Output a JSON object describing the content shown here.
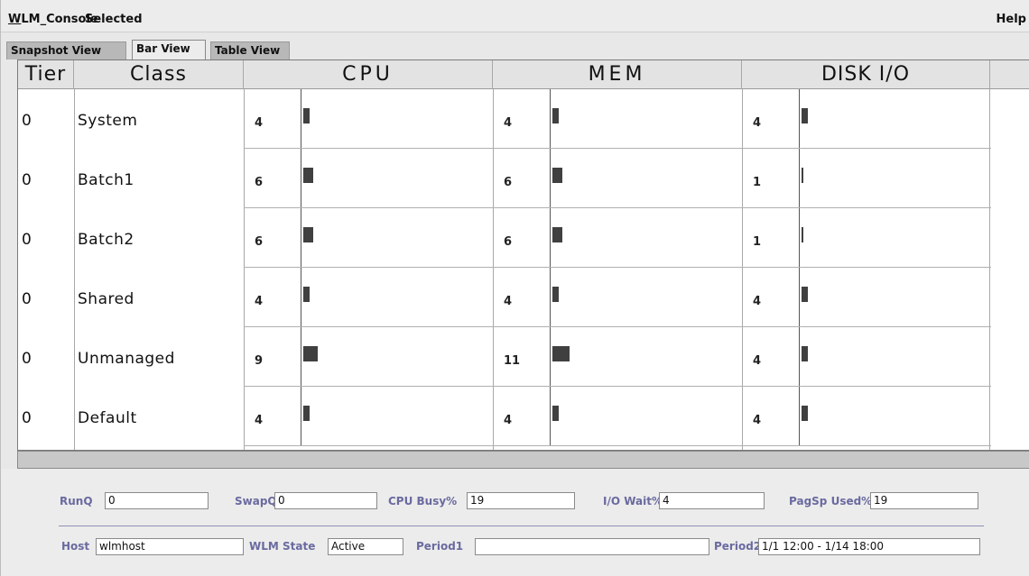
{
  "menu": {
    "console_label_mnemonic": "W",
    "console_label_rest": "LM_Console",
    "selected_label": "Selected",
    "help_label": "Help"
  },
  "tabs": [
    {
      "label": "Snapshot View",
      "active": false
    },
    {
      "label": "Bar View",
      "active": true
    },
    {
      "label": "Table View",
      "active": false
    }
  ],
  "table": {
    "headers": {
      "tier": "Tier",
      "class": "Class",
      "cpu": "CPU",
      "mem": "MEM",
      "disk": "DISK I/O"
    },
    "rows": [
      {
        "tier": "0",
        "class": "System",
        "cpu": 4,
        "mem": 4,
        "disk": 4
      },
      {
        "tier": "0",
        "class": "Batch1",
        "cpu": 6,
        "mem": 6,
        "disk": 1
      },
      {
        "tier": "0",
        "class": "Batch2",
        "cpu": 6,
        "mem": 6,
        "disk": 1
      },
      {
        "tier": "0",
        "class": "Shared",
        "cpu": 4,
        "mem": 4,
        "disk": 4
      },
      {
        "tier": "0",
        "class": "Unmanaged",
        "cpu": 9,
        "mem": 11,
        "disk": 4
      },
      {
        "tier": "0",
        "class": "Default",
        "cpu": 4,
        "mem": 4,
        "disk": 4
      }
    ]
  },
  "status": {
    "runq": {
      "label": "RunQ",
      "value": "0"
    },
    "swapq": {
      "label": "SwapQ",
      "value": "0"
    },
    "cpu_busy": {
      "label": "CPU Busy%",
      "value": "19"
    },
    "io_wait": {
      "label": "I/O Wait%",
      "value": "4"
    },
    "pagsp_used": {
      "label": "PagSp Used%",
      "value": "19"
    },
    "host": {
      "label": "Host",
      "value": "wlmhost"
    },
    "wlm_state": {
      "label": "WLM State",
      "value": "Active"
    },
    "period1": {
      "label": "Period1",
      "value": ""
    },
    "period2": {
      "label": "Period2",
      "value": "1/1 12:00 - 1/14 18:00"
    }
  },
  "colors": {
    "bar": "#404040",
    "status_label": "#6a6aa0"
  }
}
